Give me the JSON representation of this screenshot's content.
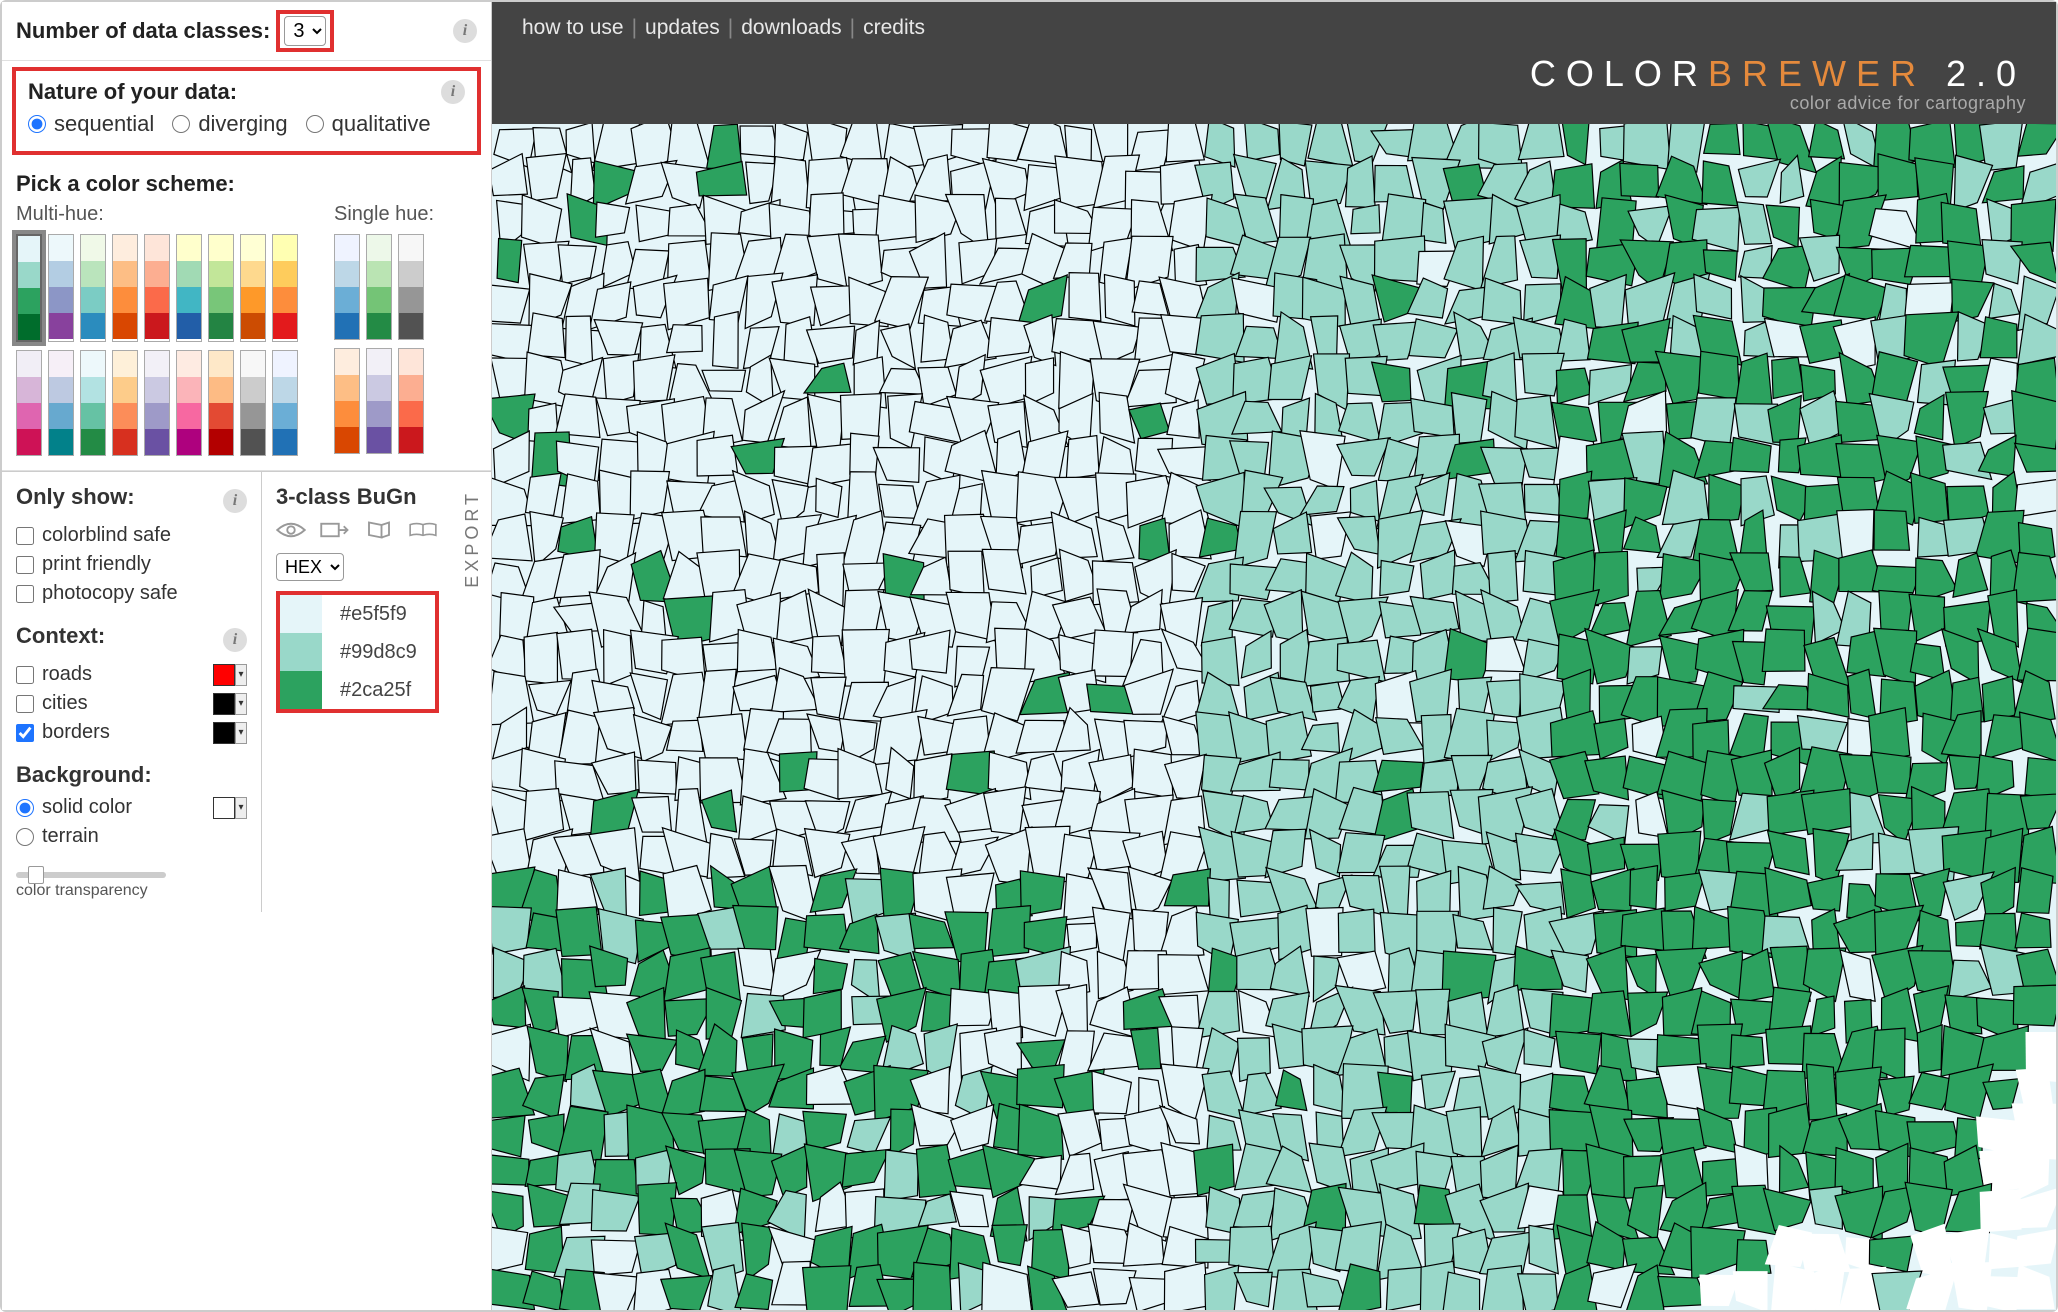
{
  "header": {
    "links": [
      "how to use",
      "updates",
      "downloads",
      "credits"
    ],
    "brand_a": "COLOR",
    "brand_b": "BREWER",
    "brand_ver": " 2.0",
    "subtitle": "color advice for cartography"
  },
  "classes": {
    "label": "Number of data classes:",
    "value": "3"
  },
  "nature": {
    "label": "Nature of your data:",
    "options": {
      "sequential": "sequential",
      "diverging": "diverging",
      "qualitative": "qualitative"
    },
    "selected": "sequential"
  },
  "scheme": {
    "title": "Pick a color scheme:",
    "multi_label": "Multi-hue:",
    "single_label": "Single hue:",
    "multi_row1": [
      [
        "#e5f5f9",
        "#99d8c9",
        "#2ca25f",
        "#006d2c"
      ],
      [
        "#edf8fb",
        "#b3cde3",
        "#8c96c6",
        "#88419d"
      ],
      [
        "#f0f9e8",
        "#bae4bc",
        "#7bccc4",
        "#2b8cbe"
      ],
      [
        "#feedde",
        "#fdbe85",
        "#fd8d3c",
        "#d94701"
      ],
      [
        "#fee5d9",
        "#fcae91",
        "#fb6a4a",
        "#cb181d"
      ],
      [
        "#ffffcc",
        "#a1dab4",
        "#41b6c4",
        "#225ea8"
      ],
      [
        "#ffffcc",
        "#c2e699",
        "#78c679",
        "#238443"
      ],
      [
        "#ffffd4",
        "#fed98e",
        "#fe9929",
        "#cc4c02"
      ],
      [
        "#ffffb2",
        "#fecc5c",
        "#fd8d3c",
        "#e31a1c"
      ]
    ],
    "multi_row2": [
      [
        "#f1eef6",
        "#d7b5d8",
        "#df65b0",
        "#ce1256"
      ],
      [
        "#f6eff7",
        "#bdc9e1",
        "#67a9cf",
        "#02818a"
      ],
      [
        "#edf8fb",
        "#b2e2e2",
        "#66c2a4",
        "#238b45"
      ],
      [
        "#fef0d9",
        "#fdcc8a",
        "#fc8d59",
        "#d7301f"
      ],
      [
        "#f2f0f7",
        "#cbc9e2",
        "#9e9ac8",
        "#6a51a3"
      ],
      [
        "#feebe2",
        "#fbb4b9",
        "#f768a1",
        "#ae017e"
      ],
      [
        "#fee8c8",
        "#fdbb84",
        "#e34a33",
        "#b30000"
      ],
      [
        "#f7f7f7",
        "#cccccc",
        "#969696",
        "#525252"
      ],
      [
        "#eff3ff",
        "#bdd7e7",
        "#6baed6",
        "#2171b5"
      ]
    ],
    "single_row1": [
      [
        "#eff3ff",
        "#bdd7e7",
        "#6baed6",
        "#2171b5"
      ],
      [
        "#edf8e9",
        "#bae4b3",
        "#74c476",
        "#238b45"
      ],
      [
        "#f7f7f7",
        "#cccccc",
        "#969696",
        "#525252"
      ]
    ],
    "single_row2": [
      [
        "#feedde",
        "#fdbe85",
        "#fd8d3c",
        "#d94701"
      ],
      [
        "#f2f0f7",
        "#cbc9e2",
        "#9e9ac8",
        "#6a51a3"
      ],
      [
        "#fee5d9",
        "#fcae91",
        "#fb6a4a",
        "#cb181d"
      ]
    ]
  },
  "filters": {
    "only_show": "Only show:",
    "colorblind": "colorblind safe",
    "print": "print friendly",
    "photocopy": "photocopy safe",
    "context": "Context:",
    "roads": "roads",
    "cities": "cities",
    "borders": "borders",
    "roads_color": "#ff0000",
    "cities_color": "#000000",
    "borders_color": "#000000",
    "background": "Background:",
    "solid": "solid color",
    "terrain": "terrain",
    "bg_color": "#ffffff",
    "transparency": "color transparency"
  },
  "detail": {
    "name": "3-class BuGn",
    "export": "EXPORT",
    "format": "HEX",
    "colors": [
      {
        "hex": "#e5f5f9"
      },
      {
        "hex": "#99d8c9"
      },
      {
        "hex": "#2ca25f"
      }
    ]
  },
  "map_colors": {
    "c1": "#e5f5f9",
    "c2": "#99d8c9",
    "c3": "#2ca25f",
    "stroke": "#000"
  }
}
